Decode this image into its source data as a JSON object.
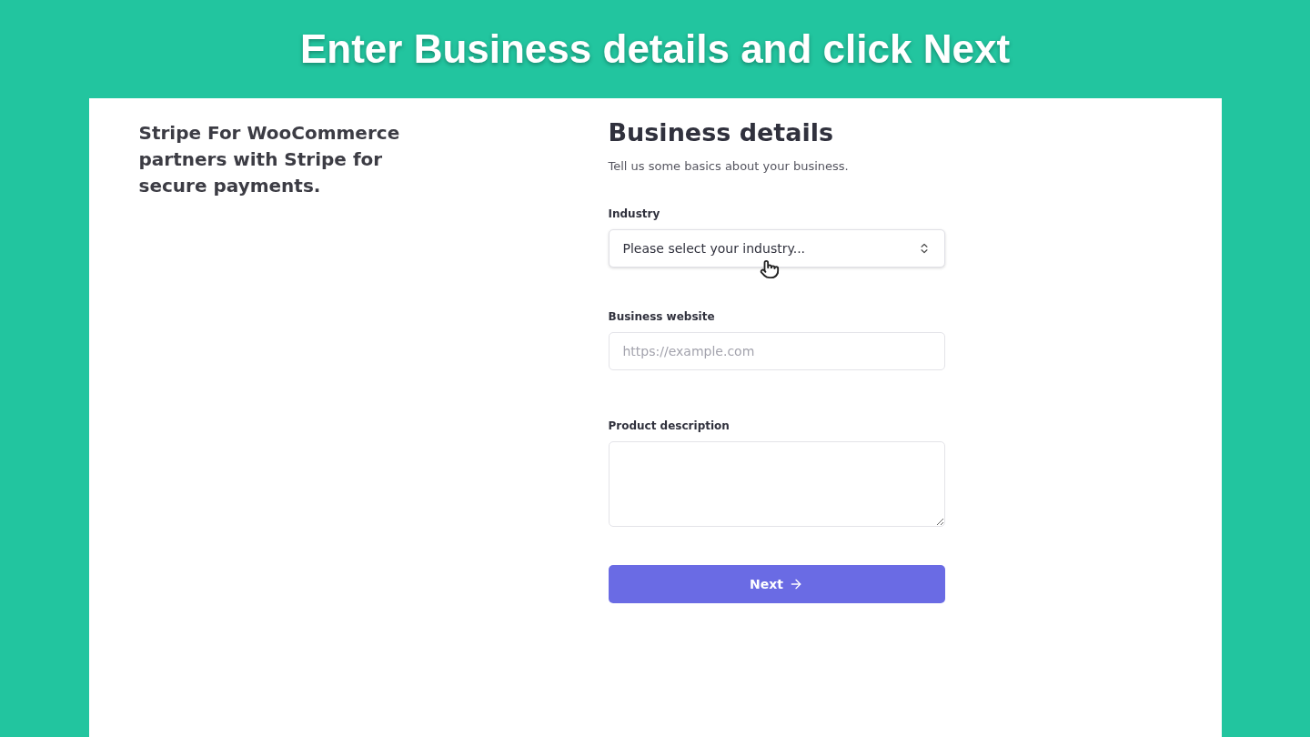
{
  "banner": {
    "title": "Enter Business details and click Next"
  },
  "sidebar": {
    "text": "Stripe For WooCommerce partners with Stripe for secure payments."
  },
  "form": {
    "title": "Business details",
    "subtitle": "Tell us some basics about your business.",
    "fields": [
      {
        "kind": "select",
        "label": "Industry",
        "value": "Please select your industry..."
      },
      {
        "kind": "text",
        "label": "Business website",
        "placeholder": "https://example.com"
      },
      {
        "kind": "textarea",
        "label": "Product description"
      }
    ],
    "next_button": {
      "label": "Next"
    }
  }
}
